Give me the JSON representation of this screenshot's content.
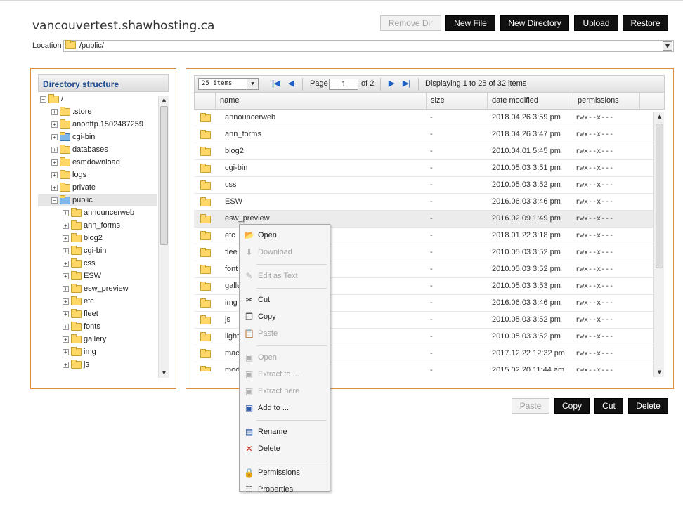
{
  "site_title": "vancouvertest.shawhosting.ca",
  "top_buttons": {
    "remove_dir": "Remove Dir",
    "new_file": "New File",
    "new_directory": "New Directory",
    "upload": "Upload",
    "restore": "Restore"
  },
  "location": {
    "label": "Location",
    "path": "/public/"
  },
  "tree": {
    "title": "Directory structure",
    "items": [
      {
        "label": "/",
        "expanded": true
      },
      {
        "label": ".store"
      },
      {
        "label": "anonftp.1502487259"
      },
      {
        "label": "cgi-bin",
        "icon": "globe-folder-icon"
      },
      {
        "label": "databases"
      },
      {
        "label": "esmdownload"
      },
      {
        "label": "logs"
      },
      {
        "label": "private"
      },
      {
        "label": "public",
        "expanded": true,
        "selected": true,
        "icon": "globe-folder-icon"
      },
      {
        "label": "announcerweb"
      },
      {
        "label": "ann_forms"
      },
      {
        "label": "blog2"
      },
      {
        "label": "cgi-bin"
      },
      {
        "label": "css"
      },
      {
        "label": "ESW"
      },
      {
        "label": "esw_preview"
      },
      {
        "label": "etc"
      },
      {
        "label": "fleet"
      },
      {
        "label": "fonts"
      },
      {
        "label": "gallery"
      },
      {
        "label": "img"
      },
      {
        "label": "js"
      }
    ]
  },
  "pager": {
    "page_size": "25 items",
    "page_label": "Page",
    "page_value": "1",
    "of_label": "of 2",
    "display_text": "Displaying 1 to 25 of 32 items"
  },
  "columns": {
    "name": "name",
    "size": "size",
    "date": "date modified",
    "perm": "permissions"
  },
  "files": [
    {
      "name": "announcerweb",
      "size": "-",
      "date": "2018.04.26 3:59 pm",
      "perm": "rwx--x---"
    },
    {
      "name": "ann_forms",
      "size": "-",
      "date": "2018.04.26 3:47 pm",
      "perm": "rwx--x---"
    },
    {
      "name": "blog2",
      "size": "-",
      "date": "2010.04.01 5:45 pm",
      "perm": "rwx--x---"
    },
    {
      "name": "cgi-bin",
      "size": "-",
      "date": "2010.05.03 3:51 pm",
      "perm": "rwx--x---"
    },
    {
      "name": "css",
      "size": "-",
      "date": "2010.05.03 3:52 pm",
      "perm": "rwx--x---"
    },
    {
      "name": "ESW",
      "size": "-",
      "date": "2016.06.03 3:46 pm",
      "perm": "rwx--x---"
    },
    {
      "name": "esw_preview",
      "size": "-",
      "date": "2016.02.09 1:49 pm",
      "perm": "rwx--x---",
      "highlighted": true
    },
    {
      "name": "etc",
      "size": "-",
      "date": "2018.01.22 3:18 pm",
      "perm": "rwx--x---"
    },
    {
      "name": "flee",
      "size": "-",
      "date": "2010.05.03 3:52 pm",
      "perm": "rwx--x---"
    },
    {
      "name": "font",
      "size": "-",
      "date": "2010.05.03 3:52 pm",
      "perm": "rwx--x---"
    },
    {
      "name": "galle",
      "size": "-",
      "date": "2010.05.03 3:53 pm",
      "perm": "rwx--x---"
    },
    {
      "name": "img",
      "size": "-",
      "date": "2016.06.03 3:46 pm",
      "perm": "rwx--x---"
    },
    {
      "name": "js",
      "size": "-",
      "date": "2010.05.03 3:52 pm",
      "perm": "rwx--x---"
    },
    {
      "name": "light",
      "size": "-",
      "date": "2010.05.03 3:52 pm",
      "perm": "rwx--x---"
    },
    {
      "name": "mac",
      "size": "-",
      "date": "2017.12.22 12:32 pm",
      "perm": "rwx--x---"
    },
    {
      "name": "mod",
      "size": "-",
      "date": "2015.02.20 11:44 am",
      "perm": "rwx--x---"
    }
  ],
  "bottom_buttons": {
    "paste": "Paste",
    "copy": "Copy",
    "cut": "Cut",
    "delete": "Delete"
  },
  "context_menu": [
    {
      "label": "Open",
      "icon": "open-folder-icon",
      "disabled": false
    },
    {
      "label": "Download",
      "icon": "download-icon",
      "disabled": true
    },
    {
      "sep": true
    },
    {
      "label": "Edit as Text",
      "icon": "edit-icon",
      "disabled": true
    },
    {
      "sep": true
    },
    {
      "label": "Cut",
      "icon": "scissors-icon",
      "disabled": false
    },
    {
      "label": "Copy",
      "icon": "copy-icon",
      "disabled": false
    },
    {
      "label": "Paste",
      "icon": "paste-icon",
      "disabled": true
    },
    {
      "sep": true
    },
    {
      "label": "Open",
      "icon": "archive-open-icon",
      "disabled": true
    },
    {
      "label": "Extract to ...",
      "icon": "archive-extract-icon",
      "disabled": true
    },
    {
      "label": "Extract here",
      "icon": "archive-extract-here-icon",
      "disabled": true
    },
    {
      "label": "Add to ...",
      "icon": "archive-add-icon",
      "disabled": false
    },
    {
      "sep": true
    },
    {
      "label": "Rename",
      "icon": "rename-icon",
      "disabled": false
    },
    {
      "label": "Delete",
      "icon": "delete-icon",
      "disabled": false
    },
    {
      "sep": true
    },
    {
      "label": "Permissions",
      "icon": "lock-icon",
      "disabled": false
    },
    {
      "label": "Properties",
      "icon": "properties-icon",
      "disabled": false
    }
  ],
  "colors": {
    "panel_border": "#e08a3c",
    "tree_title": "#1c4b8f",
    "button_bg": "#111111"
  }
}
